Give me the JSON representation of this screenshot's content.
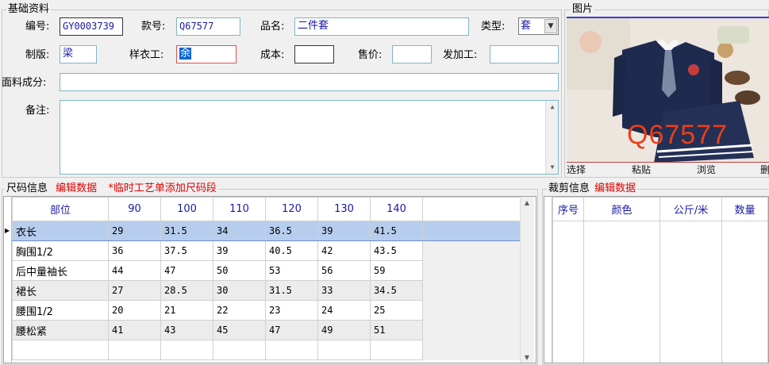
{
  "basic": {
    "title": "基础资料",
    "labels": {
      "code": "编号:",
      "style_no": "款号:",
      "product_name": "品名:",
      "type": "类型:",
      "plate_maker": "制版:",
      "sample_worker": "样衣工:",
      "cost": "成本:",
      "price": "售价:",
      "processor": "发加工:",
      "fabric": "面料成分:",
      "remark": "备注:"
    },
    "values": {
      "code": "GY0003739",
      "style_no": "Q67577",
      "product_name": "二件套",
      "type": "套",
      "plate_maker": "梁",
      "sample_worker": "余",
      "cost": "",
      "price": "",
      "processor": "",
      "fabric": "",
      "remark": ""
    }
  },
  "photo": {
    "title": "图片",
    "watermark": "Q67577",
    "buttons": [
      "选择",
      "粘贴",
      "浏览",
      "删"
    ]
  },
  "size": {
    "title": "尺码信息",
    "edit_link": "编辑数据",
    "note": "*临时工艺单添加尺码段",
    "columns": [
      "部位",
      "90",
      "100",
      "110",
      "120",
      "130",
      "140"
    ],
    "rows": [
      [
        "衣长",
        "29",
        "31.5",
        "34",
        "36.5",
        "39",
        "41.5"
      ],
      [
        "胸围1/2",
        "36",
        "37.5",
        "39",
        "40.5",
        "42",
        "43.5"
      ],
      [
        "后中量袖长",
        "44",
        "47",
        "50",
        "53",
        "56",
        "59"
      ],
      [
        "裙长",
        "27",
        "28.5",
        "30",
        "31.5",
        "33",
        "34.5"
      ],
      [
        "腰围1/2",
        "20",
        "21",
        "22",
        "23",
        "24",
        "25"
      ],
      [
        "腰松紧",
        "41",
        "43",
        "45",
        "47",
        "49",
        "51"
      ]
    ]
  },
  "cut": {
    "title": "裁剪信息",
    "edit_link": "编辑数据",
    "columns": [
      "序号",
      "颜色",
      "公斤/米",
      "数量"
    ]
  },
  "colors": {
    "accent_blue": "#1a1aa6",
    "link_red": "#e00000",
    "selected_row": "#b7cdee"
  }
}
